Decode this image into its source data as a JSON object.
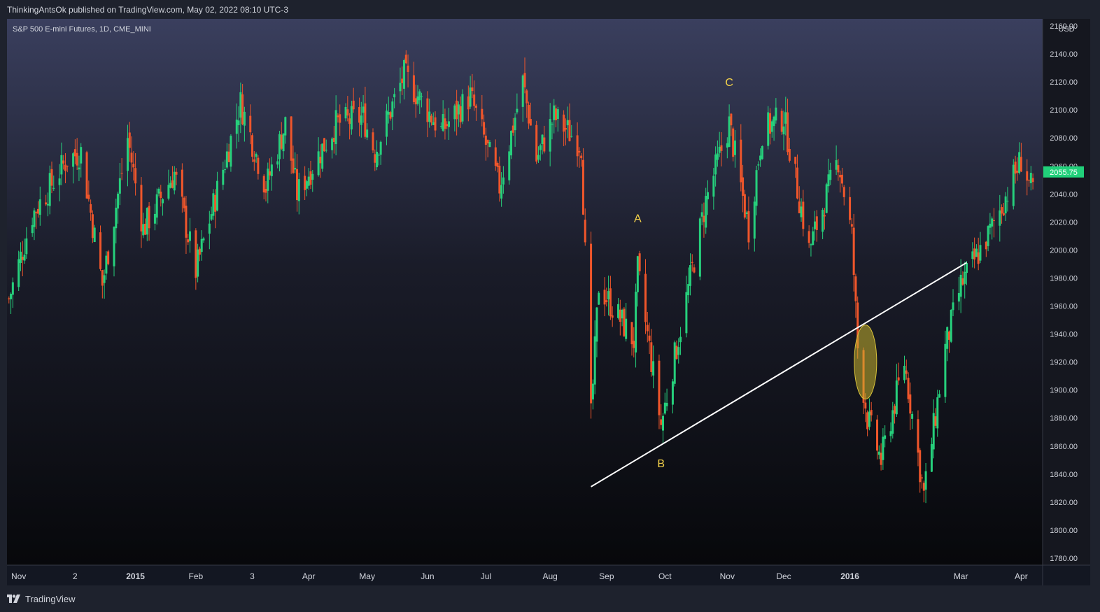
{
  "header": {
    "published": "ThinkingAntsOk published on TradingView.com, May 02, 2022 08:10 UTC-3"
  },
  "chart_header": {
    "symbol": "S&P 500 E-mini Futures, 1D, CME_MINI"
  },
  "footer": {
    "brand": "TradingView",
    "logo_icon": "tradingview-logo-icon"
  },
  "colors": {
    "up": "#26d07c",
    "down": "#f0562b",
    "trendline": "#ffffff",
    "label": "#f5d34a",
    "price_tag": "#21d07a",
    "ellipse": "#c9b42d"
  },
  "chart_data": {
    "type": "candlestick",
    "currency": "USD",
    "ylim": [
      1775,
      2165
    ],
    "y_ticks": [
      1780,
      1800,
      1820,
      1840,
      1860,
      1880,
      1900,
      1920,
      1940,
      1960,
      1980,
      2000,
      2020,
      2040,
      2060,
      2080,
      2100,
      2120,
      2140,
      2160
    ],
    "x_ticks": [
      {
        "label": "Nov",
        "date": "2014-11-03"
      },
      {
        "label": "2",
        "date": "2014-12-02"
      },
      {
        "label": "2015",
        "date": "2015-01-02"
      },
      {
        "label": "Feb",
        "date": "2015-02-02"
      },
      {
        "label": "3",
        "date": "2015-03-03"
      },
      {
        "label": "Apr",
        "date": "2015-04-01"
      },
      {
        "label": "May",
        "date": "2015-05-01"
      },
      {
        "label": "Jun",
        "date": "2015-06-01"
      },
      {
        "label": "Jul",
        "date": "2015-07-01"
      },
      {
        "label": "Aug",
        "date": "2015-08-03"
      },
      {
        "label": "Sep",
        "date": "2015-09-01"
      },
      {
        "label": "Oct",
        "date": "2015-10-01"
      },
      {
        "label": "Nov",
        "date": "2015-11-02"
      },
      {
        "label": "Dec",
        "date": "2015-12-01"
      },
      {
        "label": "2016",
        "date": "2016-01-04"
      },
      {
        "label": "Mar",
        "date": "2016-03-01"
      },
      {
        "label": "Apr",
        "date": "2016-04-01"
      }
    ],
    "last_price": "2055.75",
    "waypoints": [
      [
        "2014-10-29",
        1965
      ],
      [
        "2014-11-10",
        2025
      ],
      [
        "2014-11-28",
        2065
      ],
      [
        "2014-12-05",
        2070
      ],
      [
        "2014-12-16",
        1975
      ],
      [
        "2014-12-29",
        2080
      ],
      [
        "2015-01-06",
        2015
      ],
      [
        "2015-01-22",
        2055
      ],
      [
        "2015-02-02",
        1985
      ],
      [
        "2015-02-25",
        2105
      ],
      [
        "2015-03-10",
        2045
      ],
      [
        "2015-03-20",
        2090
      ],
      [
        "2015-03-26",
        2040
      ],
      [
        "2015-04-15",
        2090
      ],
      [
        "2015-04-29",
        2095
      ],
      [
        "2015-05-05",
        2070
      ],
      [
        "2015-05-20",
        2125
      ],
      [
        "2015-06-08",
        2085
      ],
      [
        "2015-06-23",
        2110
      ],
      [
        "2015-07-08",
        2045
      ],
      [
        "2015-07-20",
        2120
      ],
      [
        "2015-07-27",
        2065
      ],
      [
        "2015-08-05",
        2095
      ],
      [
        "2015-08-19",
        2075
      ],
      [
        "2015-08-24",
        1880
      ],
      [
        "2015-08-28",
        1975
      ],
      [
        "2015-09-15",
        1935
      ],
      [
        "2015-09-17",
        1985
      ],
      [
        "2015-09-29",
        1875
      ],
      [
        "2015-10-22",
        2035
      ],
      [
        "2015-11-03",
        2090
      ],
      [
        "2015-11-13",
        2015
      ],
      [
        "2015-11-20",
        2085
      ],
      [
        "2015-12-01",
        2095
      ],
      [
        "2015-12-14",
        2000
      ],
      [
        "2015-12-29",
        2065
      ],
      [
        "2016-01-05",
        2010
      ],
      [
        "2016-01-08",
        1930
      ],
      [
        "2016-01-13",
        1880
      ],
      [
        "2016-01-20",
        1850
      ],
      [
        "2016-02-01",
        1920
      ],
      [
        "2016-02-11",
        1825
      ],
      [
        "2016-02-22",
        1930
      ],
      [
        "2016-03-01",
        1975
      ],
      [
        "2016-03-15",
        2010
      ],
      [
        "2016-03-23",
        2035
      ],
      [
        "2016-04-01",
        2065
      ],
      [
        "2016-04-07",
        2040
      ]
    ],
    "annotations": [
      {
        "type": "text",
        "text": "A",
        "date": "2015-09-17",
        "y": 2020
      },
      {
        "type": "text",
        "text": "B",
        "date": "2015-09-29",
        "y": 1845
      },
      {
        "type": "text",
        "text": "C",
        "date": "2015-11-03",
        "y": 2117
      },
      {
        "type": "trendline",
        "from": {
          "date": "2015-08-24",
          "y": 1831
        },
        "to": {
          "date": "2016-03-04",
          "y": 1991
        }
      },
      {
        "type": "ellipse",
        "date": "2016-01-12",
        "y": 1920
      }
    ]
  }
}
